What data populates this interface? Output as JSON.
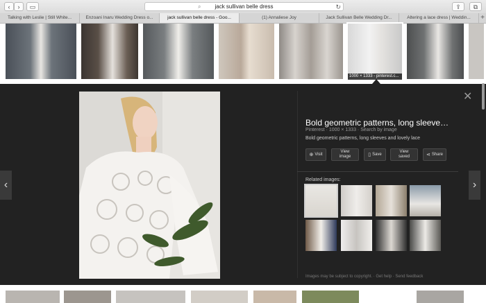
{
  "browser": {
    "url": "jack sullivan belle dress",
    "tabs": [
      {
        "label": "Talking with Leslie | Still White...",
        "active": false
      },
      {
        "label": "Enzoani Inaru Wedding Dress o...",
        "active": false
      },
      {
        "label": "jack sullivan belle dress - Goo...",
        "active": true
      },
      {
        "label": "(1) Annaliese Joy",
        "active": false
      },
      {
        "label": "Jack Sullivan Belle Wedding Dr...",
        "active": false
      },
      {
        "label": "Altering a lace dress | Weddin...",
        "active": false
      }
    ]
  },
  "strip": {
    "selected_label": "1000 × 1333 - pinterest.c..."
  },
  "viewer": {
    "title": "Bold geometric patterns, long sleeve…",
    "meta": "Pinterest · 1000 × 1333 · Search by image",
    "description": "Bold geometric patterns, long sleeves and lovely lace",
    "buttons": {
      "visit": "Visit",
      "view_image": [
        "View",
        "image"
      ],
      "save": "Save",
      "view_saved": [
        "View",
        "saved"
      ],
      "share": "Share"
    },
    "related_label": "Related images:",
    "footer": "Images may be subject to copyright. · Get help · Send feedback"
  },
  "colors": {
    "viewer_bg": "#222222",
    "accent": "#ffffff"
  }
}
